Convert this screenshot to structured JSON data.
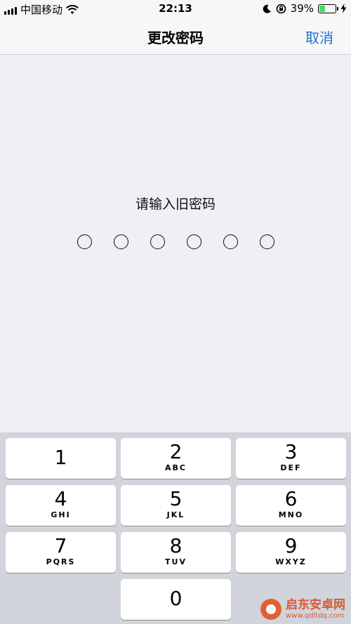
{
  "status_bar": {
    "carrier": "中国移动",
    "time": "22:13",
    "battery_percent": "39%",
    "battery_level": 0.39,
    "battery_color": "#4cd964"
  },
  "nav": {
    "title": "更改密码",
    "cancel_label": "取消",
    "accent_color": "#1f6fd6"
  },
  "prompt": {
    "text": "请输入旧密码",
    "passcode_length": 6
  },
  "keypad": {
    "keys": [
      {
        "num": "1",
        "letters": ""
      },
      {
        "num": "2",
        "letters": "ABC"
      },
      {
        "num": "3",
        "letters": "DEF"
      },
      {
        "num": "4",
        "letters": "GHI"
      },
      {
        "num": "5",
        "letters": "JKL"
      },
      {
        "num": "6",
        "letters": "MNO"
      },
      {
        "num": "7",
        "letters": "PQRS"
      },
      {
        "num": "8",
        "letters": "TUV"
      },
      {
        "num": "9",
        "letters": "WXYZ"
      },
      {
        "num": "0",
        "letters": ""
      }
    ]
  },
  "watermark": {
    "name": "启东安卓网",
    "url": "www.qdltdq.com"
  }
}
